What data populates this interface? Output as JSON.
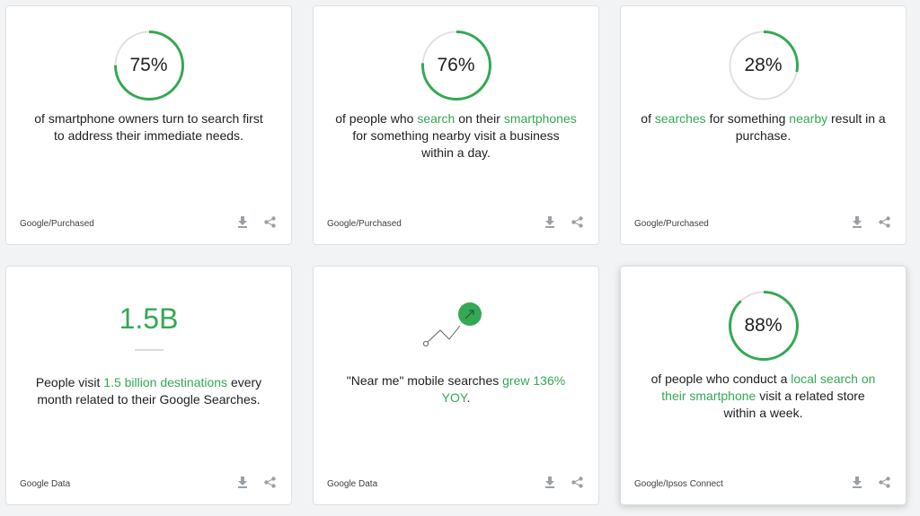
{
  "colors": {
    "accent": "#34a853",
    "ring_track": "#e0e0e0",
    "icon": "#9aa0a6"
  },
  "icons": {
    "download": "download-icon",
    "share": "share-icon",
    "trend": "trend-up-icon"
  },
  "cards": [
    {
      "stat": "75%",
      "percent": 75,
      "text": [
        {
          "t": "of smartphone owners turn to search first to address their immediate needs.",
          "hl": false
        }
      ],
      "source": "Google/Purchased"
    },
    {
      "stat": "76%",
      "percent": 76,
      "text": [
        {
          "t": "of people who ",
          "hl": false
        },
        {
          "t": "search",
          "hl": true
        },
        {
          "t": " on their ",
          "hl": false
        },
        {
          "t": "smartphones",
          "hl": true
        },
        {
          "t": " for something nearby visit a business within a day.",
          "hl": false
        }
      ],
      "source": "Google/Purchased"
    },
    {
      "stat": "28%",
      "percent": 28,
      "text": [
        {
          "t": "of ",
          "hl": false
        },
        {
          "t": "searches",
          "hl": true
        },
        {
          "t": " for something ",
          "hl": false
        },
        {
          "t": "nearby",
          "hl": true
        },
        {
          "t": " result in a purchase.",
          "hl": false
        }
      ],
      "source": "Google/Purchased"
    },
    {
      "stat": "1.5B",
      "text": [
        {
          "t": "People visit ",
          "hl": false
        },
        {
          "t": "1.5 billion destinations",
          "hl": true
        },
        {
          "t": " every month related to their Google Searches.",
          "hl": false
        }
      ],
      "source": "Google Data"
    },
    {
      "text": [
        {
          "t": "\"Near me\" mobile searches ",
          "hl": false
        },
        {
          "t": "grew 136% YOY",
          "hl": true
        },
        {
          "t": ".",
          "hl": false
        }
      ],
      "source": "Google Data"
    },
    {
      "stat": "88%",
      "percent": 88,
      "text": [
        {
          "t": "of people who conduct a ",
          "hl": false
        },
        {
          "t": "local search on their smartphone",
          "hl": true
        },
        {
          "t": " visit a related store within a week.",
          "hl": false
        }
      ],
      "source": "Google/Ipsos Connect"
    }
  ]
}
